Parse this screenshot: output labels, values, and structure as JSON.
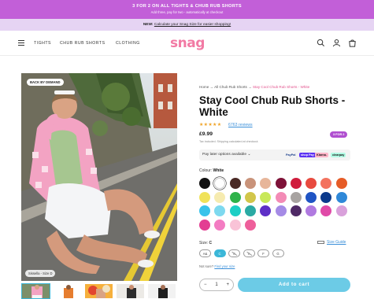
{
  "promo": {
    "line1": "3 FOR 2 ON ALL TIGHTS & CHUB RUB SHORTS",
    "line2": "Add three, pay for two - automatically at checkout"
  },
  "subpromo": {
    "bold": "NEW:",
    "text": "Calculate your Snag Size for easier shopping!"
  },
  "nav": {
    "links": [
      "TIGHTS",
      "CHUB RUB SHORTS",
      "CLOTHING"
    ],
    "logo_main": "snag",
    "icons": [
      "search-icon",
      "account-icon",
      "bag-icon"
    ]
  },
  "gallery": {
    "badge_top": "BACK BY DEMAND",
    "badge_bottom": "Sissella - Size D",
    "thumb_count": 5
  },
  "breadcrumb": {
    "home": "Home",
    "sep": "→",
    "parent": "All Chub Rub Shorts",
    "current": "Stay Cool Chub Rub Shorts - White"
  },
  "product": {
    "title": "Stay Cool Chub Rub Shorts - White",
    "stars": "★★★★★",
    "reviews": "6763 reviews",
    "price": "£9.99",
    "tag": "3 FOR 2",
    "ship_note": "Tax included. Shipping calculated at checkout."
  },
  "paylater": {
    "label": "Pay later options available",
    "chevron": "⌄",
    "providers": [
      "PayPal",
      "shop Pay",
      "Klarna.",
      "clearpay"
    ]
  },
  "colour": {
    "label": "Colour:",
    "value": "White",
    "swatches": [
      "#111111",
      "#ffffff",
      "#4a2a25",
      "#c9937a",
      "#e7b69a",
      "#7e1238",
      "#d01c3c",
      "#e84a3f",
      "#f3735f",
      "#e65c27",
      "#f0e25a",
      "#f6ebb0",
      "#2fb24a",
      "#d2c64a",
      "#c8e85a",
      "#f38bb6",
      "#a8a3a1",
      "#1f54c4",
      "#0c3a8c",
      "#2f88d8",
      "#39c3ea",
      "#7ed9ef",
      "#1ecfc5",
      "#2baaa4",
      "#5e2fc7",
      "#a58be6",
      "#4f2a66",
      "#b07ae0",
      "#e04aa8",
      "#d9a1db",
      "#e33d92",
      "#f37cc2",
      "#f9c3d7",
      "#ee5f9b"
    ],
    "selected_index": 1
  },
  "size": {
    "label": "Size:",
    "value": "C",
    "guide": "Size Guide",
    "options": [
      "A&",
      "C",
      "D",
      "E",
      "F",
      "G"
    ],
    "selected_index": 1,
    "unavailable": [
      2,
      3
    ],
    "notsure": "Not sure?",
    "notsure_link": "Find your size"
  },
  "cart": {
    "qty_minus": "−",
    "qty": "1",
    "qty_plus": "+",
    "add_label": "Add to cart"
  }
}
